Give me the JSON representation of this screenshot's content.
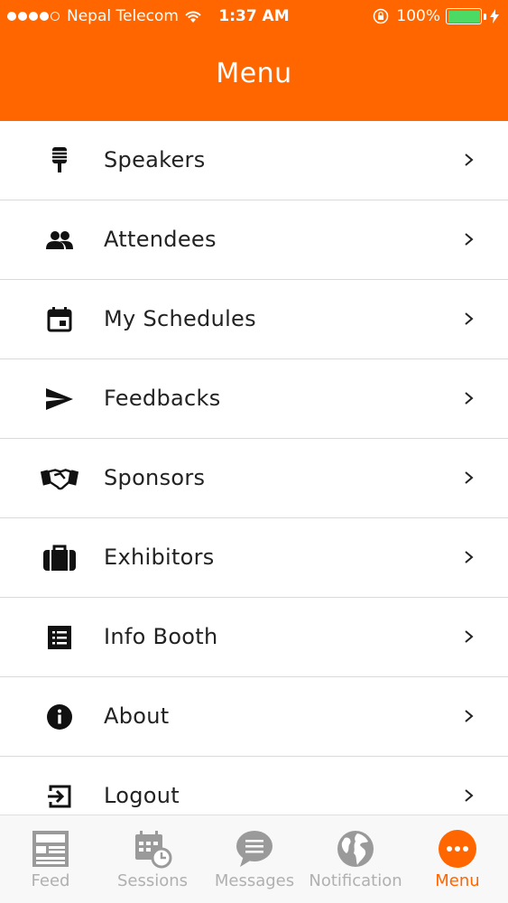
{
  "status_bar": {
    "carrier": "Nepal Telecom",
    "time": "1:37 AM",
    "battery": "100%"
  },
  "header": {
    "title": "Menu"
  },
  "menu": {
    "items": [
      {
        "label": "Speakers",
        "icon": "microphone-icon"
      },
      {
        "label": "Attendees",
        "icon": "people-icon"
      },
      {
        "label": "My Schedules",
        "icon": "calendar-icon"
      },
      {
        "label": "Feedbacks",
        "icon": "send-icon"
      },
      {
        "label": "Sponsors",
        "icon": "handshake-icon"
      },
      {
        "label": "Exhibitors",
        "icon": "briefcase-icon"
      },
      {
        "label": "Info Booth",
        "icon": "list-icon"
      },
      {
        "label": "About",
        "icon": "info-icon"
      },
      {
        "label": "Logout",
        "icon": "logout-icon"
      }
    ]
  },
  "tabbar": {
    "tabs": [
      {
        "label": "Feed",
        "icon": "feed-icon"
      },
      {
        "label": "Sessions",
        "icon": "sessions-icon"
      },
      {
        "label": "Messages",
        "icon": "messages-icon"
      },
      {
        "label": "Notification",
        "icon": "globe-icon"
      },
      {
        "label": "Menu",
        "icon": "more-icon"
      }
    ],
    "active": "Menu"
  },
  "colors": {
    "accent": "#ff6600",
    "inactive_tab": "#b0b0b0",
    "battery": "#4cd964"
  }
}
